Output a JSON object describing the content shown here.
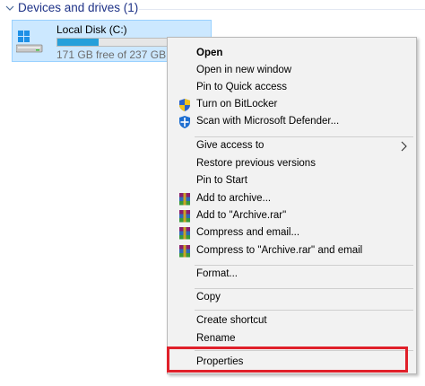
{
  "group": {
    "title": "Devices and drives (1)"
  },
  "drive": {
    "name": "Local Disk (C:)",
    "free_text": "171 GB free of 237 GB",
    "used_fraction": 0.28
  },
  "menu": {
    "items": [
      {
        "label": "Open",
        "bold": true
      },
      {
        "label": "Open in new window"
      },
      {
        "label": "Pin to Quick access"
      },
      {
        "label": "Turn on BitLocker",
        "icon": "uac-shield-icon"
      },
      {
        "label": "Scan with Microsoft Defender...",
        "icon": "defender-icon"
      },
      {
        "label": "Give access to",
        "submenu": true
      },
      {
        "label": "Restore previous versions"
      },
      {
        "label": "Pin to Start"
      },
      {
        "label": "Add to archive...",
        "icon": "winrar-icon"
      },
      {
        "label": "Add to \"Archive.rar\"",
        "icon": "winrar-icon"
      },
      {
        "label": "Compress and email...",
        "icon": "winrar-icon"
      },
      {
        "label": "Compress to \"Archive.rar\" and email",
        "icon": "winrar-icon"
      },
      {
        "label": "Format..."
      },
      {
        "label": "Copy"
      },
      {
        "label": "Create shortcut"
      },
      {
        "label": "Rename"
      },
      {
        "label": "Properties",
        "highlighted": true
      }
    ]
  },
  "colors": {
    "highlight_border": "#e0202a",
    "selection_bg": "#cce8ff",
    "group_title": "#1e3287",
    "progress_fill": "#26a0da"
  }
}
